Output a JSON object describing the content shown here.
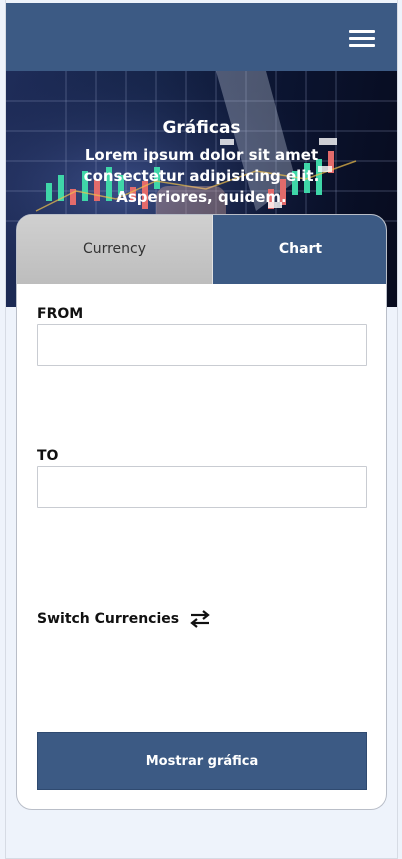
{
  "header": {
    "menu_icon": "hamburger-menu-icon",
    "bg_color": "#3c5a84"
  },
  "hero": {
    "title": "Gráficas",
    "subtitle": "Lorem ipsum dolor sit amet consectetur adipisicing elit. Asperiores, quidem."
  },
  "tabs": [
    {
      "label": "Currency",
      "active": false
    },
    {
      "label": "Chart",
      "active": true
    }
  ],
  "form": {
    "from_label": "FROM",
    "from_value": "",
    "to_label": "TO",
    "to_value": "",
    "switch_label": "Switch Currencies",
    "switch_icon": "swap-arrows-icon",
    "submit_label": "Mostrar gráfica"
  },
  "colors": {
    "primary": "#3c5a84",
    "page_bg": "#eef3fb",
    "tab_inactive": "#c8c8c8"
  }
}
